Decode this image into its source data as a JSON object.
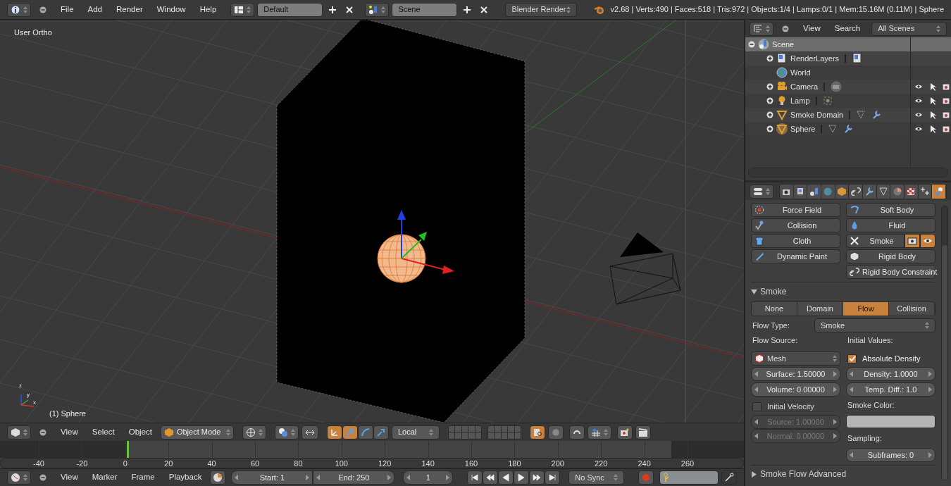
{
  "top_bar": {
    "menus": [
      "File",
      "Add",
      "Render",
      "Window",
      "Help"
    ],
    "layout": "Default",
    "scene": "Scene",
    "engine": "Blender Render",
    "stats": "v2.68 | Verts:490 | Faces:518 | Tris:972 | Objects:1/4 | Lamps:0/1 | Mem:15.16M (0.11M) | Sphere"
  },
  "viewport": {
    "view_name": "User Ortho",
    "object_label": "(1) Sphere",
    "axis_labels": [
      "z",
      "y",
      "x"
    ]
  },
  "view3d_header": {
    "menus": [
      "View",
      "Select",
      "Object"
    ],
    "mode": "Object Mode",
    "orientation": "Local",
    "toggles": [
      {
        "kind": "manipulator",
        "selected": true
      },
      {
        "kind": "translate",
        "selected": true
      },
      {
        "kind": "rotate",
        "selected": false
      },
      {
        "kind": "scale",
        "selected": false
      }
    ],
    "lock_layers": true
  },
  "timeline": {
    "ticks": [
      "-40",
      "-20",
      "0",
      "20",
      "40",
      "60",
      "80",
      "100",
      "120",
      "140",
      "160",
      "180",
      "200",
      "220",
      "240",
      "260"
    ]
  },
  "timeline_header": {
    "menus": [
      "View",
      "Marker",
      "Frame",
      "Playback"
    ],
    "start": "Start: 1",
    "end": "End: 250",
    "current": "1",
    "sync": "No Sync"
  },
  "outliner": {
    "menus": [
      "View",
      "Search"
    ],
    "filter": "All Scenes",
    "tree": [
      {
        "label": "Scene",
        "kind": "scene",
        "selected": true,
        "expanded": true,
        "children": [
          {
            "label": "RenderLayers",
            "kind": "renderlayers",
            "selected": false,
            "expanded": false
          },
          {
            "label": "World",
            "kind": "world",
            "selected": false
          },
          {
            "label": "Camera",
            "kind": "camera",
            "selected": false,
            "expanded": false
          },
          {
            "label": "Lamp",
            "kind": "lamp",
            "selected": false,
            "expanded": false
          },
          {
            "label": "Smoke Domain",
            "kind": "mesh",
            "selected": false,
            "expanded": false
          },
          {
            "label": "Sphere",
            "kind": "mesh",
            "selected": false,
            "active": true,
            "expanded": false
          }
        ]
      }
    ]
  },
  "properties": {
    "tabs": [
      {
        "kind": "render",
        "selected": false
      },
      {
        "kind": "layers",
        "selected": false
      },
      {
        "kind": "scene",
        "selected": false
      },
      {
        "kind": "world",
        "selected": false
      },
      {
        "kind": "object",
        "selected": false
      },
      {
        "kind": "constraints",
        "selected": false
      },
      {
        "kind": "modifiers",
        "selected": false
      },
      {
        "kind": "data",
        "selected": false
      },
      {
        "kind": "material",
        "selected": false
      },
      {
        "kind": "texture",
        "selected": false
      },
      {
        "kind": "particles",
        "selected": false
      },
      {
        "kind": "physics",
        "selected": true
      }
    ],
    "physics": [
      {
        "label": "Force Field",
        "kind": "forcefield"
      },
      {
        "label": "Soft Body",
        "kind": "softbody"
      },
      {
        "label": "Collision",
        "kind": "collision"
      },
      {
        "label": "Fluid",
        "kind": "fluid"
      },
      {
        "label": "Cloth",
        "kind": "cloth"
      },
      {
        "label": "Smoke",
        "kind": "smoke",
        "enabled": true
      },
      {
        "label": "Dynamic Paint",
        "kind": "paint"
      },
      {
        "label": "Rigid Body",
        "kind": "rigidbody"
      },
      {
        "label": "Rigid Body Constraint",
        "kind": "constraint"
      }
    ],
    "smoke_panel": {
      "title": "Smoke",
      "expanded": true,
      "types": [
        {
          "label": "None",
          "selected": false
        },
        {
          "label": "Domain",
          "selected": false
        },
        {
          "label": "Flow",
          "selected": true
        },
        {
          "label": "Collision",
          "selected": false
        }
      ],
      "flow_type_label": "Flow Type:",
      "flow_type": "Smoke",
      "flow_source_label": "Flow Source:",
      "source": "Mesh",
      "surface": "Surface: 1.50000",
      "volume": "Volume: 0.00000",
      "initial_velocity": {
        "label": "Initial Velocity",
        "checked": false
      },
      "velocity_fields": [
        {
          "text": "Source: 1.00000",
          "disabled": true
        },
        {
          "text": "Normal: 0.00000",
          "disabled": true
        }
      ],
      "initial_values_label": "Initial Values:",
      "absolute_density": {
        "label": "Absolute Density",
        "checked": true
      },
      "density": "Density: 1.0000",
      "temp_diff": "Temp. Diff.: 1.0",
      "smoke_color_label": "Smoke Color:",
      "sampling_label": "Sampling:",
      "subframes": "Subframes: 0"
    },
    "advanced_panel": {
      "title": "Smoke Flow Advanced",
      "expanded": false
    }
  }
}
